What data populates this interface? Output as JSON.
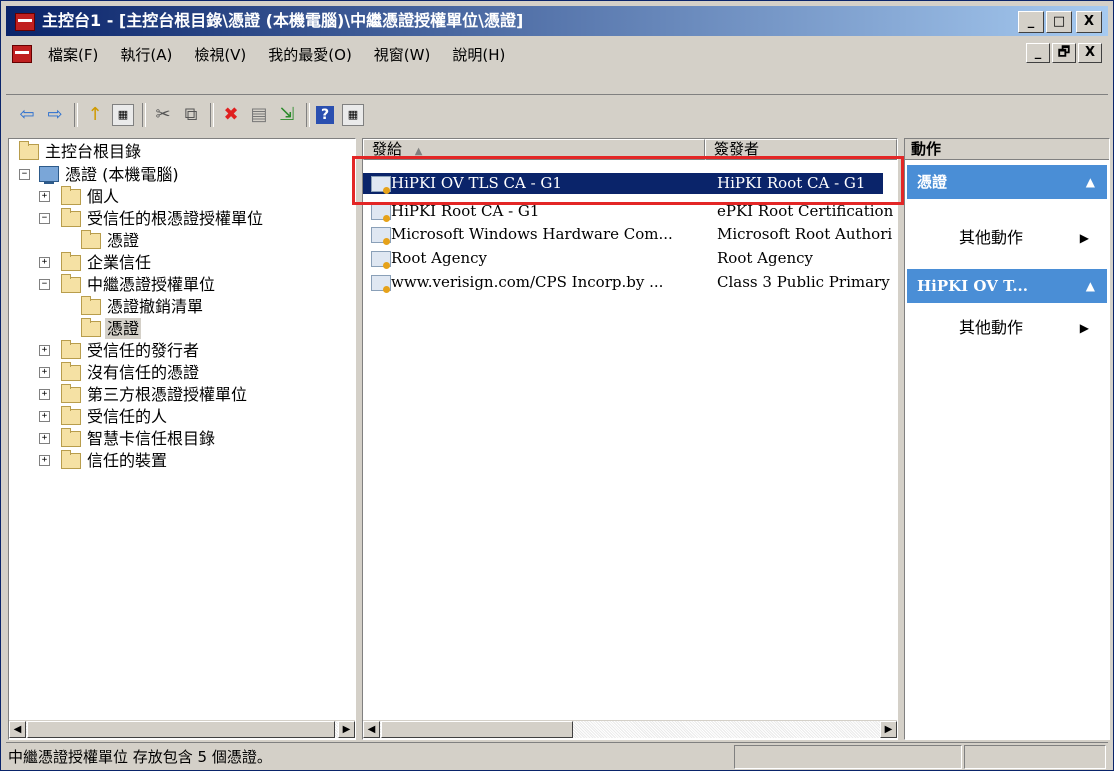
{
  "window": {
    "title": "主控台1 - [主控台根目錄\\憑證 (本機電腦)\\中繼憑證授權單位\\憑證]",
    "buttons": {
      "minimize": "_",
      "maximize": "□",
      "close": "X"
    }
  },
  "menubar": {
    "items": [
      "檔案(F)",
      "執行(A)",
      "檢視(V)",
      "我的最愛(O)",
      "視窗(W)",
      "說明(H)"
    ],
    "buttons": {
      "minimize": "_",
      "restore": "🗗",
      "close": "X"
    }
  },
  "toolbar": {
    "icons": [
      "back-icon",
      "forward-icon",
      "up-folder-icon",
      "show-hide-tree-icon",
      "cut-icon",
      "copy-icon",
      "delete-icon",
      "properties-icon",
      "export-icon",
      "help-icon",
      "show-action-pane-icon"
    ],
    "glyphs": {
      "back": "⇦",
      "forward": "⇨",
      "up": "↑",
      "cut": "✂",
      "copy": "⧉",
      "delete": "✖",
      "properties": "▤",
      "export": "⇲",
      "help": "?",
      "tree": "▦",
      "action_pane": "▦"
    }
  },
  "tree": {
    "root": "主控台根目錄",
    "computer": "憑證 (本機電腦)",
    "personal": "個人",
    "trusted_root": "受信任的根憑證授權單位",
    "trusted_root_certs": "憑證",
    "enterprise_trust": "企業信任",
    "intermediate": "中繼憑證授權單位",
    "crl": "憑證撤銷清單",
    "intermediate_certs": "憑證",
    "trusted_publishers": "受信任的發行者",
    "untrusted": "沒有信任的憑證",
    "third_party_root": "第三方根憑證授權單位",
    "trusted_people": "受信任的人",
    "smart_card_root": "智慧卡信任根目錄",
    "trusted_devices": "信任的裝置",
    "expand": "+",
    "collapse": "−"
  },
  "list": {
    "columns": [
      "發給",
      "簽發者"
    ],
    "sort_indicator": "▲",
    "rows": [
      {
        "issued_to": "HiPKI OV TLS CA - G1",
        "issued_by": "HiPKI Root CA - G1",
        "selected": true
      },
      {
        "issued_to": "HiPKI Root CA - G1",
        "issued_by": "ePKI Root Certification",
        "selected": false
      },
      {
        "issued_to": "Microsoft Windows Hardware Com...",
        "issued_by": "Microsoft Root Authori",
        "selected": false
      },
      {
        "issued_to": "Root Agency",
        "issued_by": "Root Agency",
        "selected": false
      },
      {
        "issued_to": "www.verisign.com/CPS Incorp.by ...",
        "issued_by": "Class 3 Public Primary",
        "selected": false
      }
    ]
  },
  "actions": {
    "header": "動作",
    "section1_title": "憑證",
    "section1_item": "其他動作",
    "section2_title": "HiPKI OV T...",
    "section2_item": "其他動作",
    "caret": "▲",
    "submenu_arrow": "▶"
  },
  "status": {
    "text": "中繼憑證授權單位 存放包含 5 個憑證。"
  },
  "colors": {
    "title_gradient_start": "#0a246a",
    "title_gradient_end": "#a6caf0",
    "selection": "#0a246a",
    "action_section": "#4a8ed6",
    "highlight_box": "#e32626"
  }
}
